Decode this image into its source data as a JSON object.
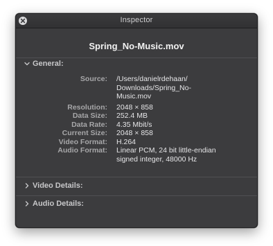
{
  "window": {
    "title": "Inspector"
  },
  "file": {
    "name": "Spring_No-Music.mov"
  },
  "sections": {
    "general": "General:",
    "video_details": "Video Details:",
    "audio_details": "Audio Details:"
  },
  "properties": {
    "source": {
      "label": "Source:",
      "lines": [
        "/Users/danielrdehaan/",
        "Downloads/Spring_No-",
        "Music.mov"
      ]
    },
    "resolution": {
      "label": "Resolution:",
      "value": "2048 × 858"
    },
    "data_size": {
      "label": "Data Size:",
      "value": "252.4 MB"
    },
    "data_rate": {
      "label": "Data Rate:",
      "value": "4.35 Mbit/s"
    },
    "current_size": {
      "label": "Current Size:",
      "value": "2048 × 858"
    },
    "video_format": {
      "label": "Video Format:",
      "value": "H.264"
    },
    "audio_format": {
      "label": "Audio Format:",
      "lines": [
        "Linear PCM, 24 bit little-endian",
        "signed integer, 48000 Hz"
      ]
    }
  },
  "icons": {
    "close": "close-icon",
    "expanded": "chevron-down-icon",
    "collapsed": "chevron-right-icon"
  }
}
